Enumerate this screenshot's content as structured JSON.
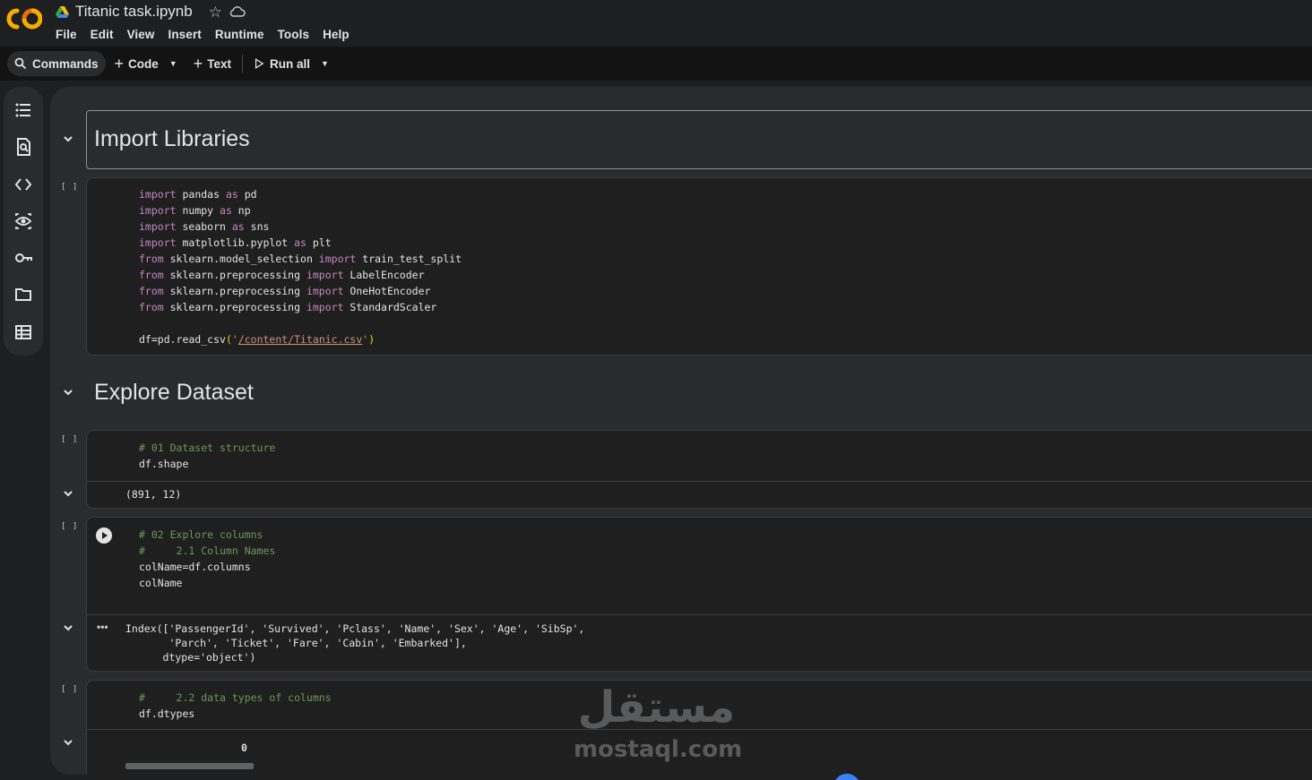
{
  "app": {
    "doc_title": "Titanic task.ipynb",
    "logo": "colab-logo",
    "menu": [
      "File",
      "Edit",
      "View",
      "Insert",
      "Runtime",
      "Tools",
      "Help"
    ]
  },
  "toolbar": {
    "commands_label": "Commands",
    "code_label": "Code",
    "text_label": "Text",
    "run_all_label": "Run all"
  },
  "sidebar": {
    "icons": [
      "table-of-contents-icon",
      "find-replace-icon",
      "code-snippets-icon",
      "variable-inspector-icon",
      "secrets-key-icon",
      "files-folder-icon",
      "data-table-icon"
    ]
  },
  "cells": {
    "md1": {
      "title": "Import Libraries"
    },
    "code1": {
      "exec_count": "[ ]",
      "lines": [
        {
          "kw": "import",
          "rest": " pandas ",
          "kw2": "as",
          "rest2": " pd"
        },
        {
          "kw": "import",
          "rest": " numpy ",
          "kw2": "as",
          "rest2": " np"
        },
        {
          "kw": "import",
          "rest": " seaborn ",
          "kw2": "as",
          "rest2": " sns"
        },
        {
          "kw": "import",
          "rest": " matplotlib.pyplot ",
          "kw2": "as",
          "rest2": " plt"
        },
        {
          "kw": "from",
          "rest": " sklearn.model_selection ",
          "kw2": "import",
          "rest2": " train_test_split"
        },
        {
          "kw": "from",
          "rest": " sklearn.preprocessing ",
          "kw2": "import",
          "rest2": " LabelEncoder"
        },
        {
          "kw": "from",
          "rest": " sklearn.preprocessing ",
          "kw2": "import",
          "rest2": " OneHotEncoder"
        },
        {
          "kw": "from",
          "rest": " sklearn.preprocessing ",
          "kw2": "import",
          "rest2": " StandardScaler"
        }
      ],
      "read_prefix": "df=pd.read_csv",
      "read_open": "(",
      "read_q1": "'",
      "read_path": "/content/Titanic.csv",
      "read_q2": "'",
      "read_close": ")"
    },
    "md2": {
      "title": "Explore Dataset"
    },
    "code2": {
      "exec_count": "[ ]",
      "comment": "# 01 Dataset structure",
      "code": "df.shape",
      "output": "(891, 12)"
    },
    "code3": {
      "exec_count": "[ ]",
      "comment1": "# 02 Explore columns",
      "comment2": "#     2.1 Column Names",
      "code1": "colName=df.columns",
      "code2": "colName",
      "output_l1": "Index(['PassengerId', 'Survived', 'Pclass', 'Name', 'Sex', 'Age', 'SibSp',",
      "output_l2": "       'Parch', 'Ticket', 'Fare', 'Cabin', 'Embarked'],",
      "output_l3": "      dtype='object')",
      "ellipsis": "•••"
    },
    "code4": {
      "exec_count": "[ ]",
      "comment": "#     2.2 data types of columns",
      "code": "df.dtypes",
      "output_header": "0"
    }
  },
  "watermark": {
    "arabic": "مستقل",
    "latin": "mostaql.com"
  },
  "colors": {
    "background": "#1e1f20",
    "cell": "#1f1f1f",
    "keyword": "#c586c0",
    "comment": "#6a9955",
    "string": "#ce9178",
    "accent_orange": "#f9ab00"
  }
}
